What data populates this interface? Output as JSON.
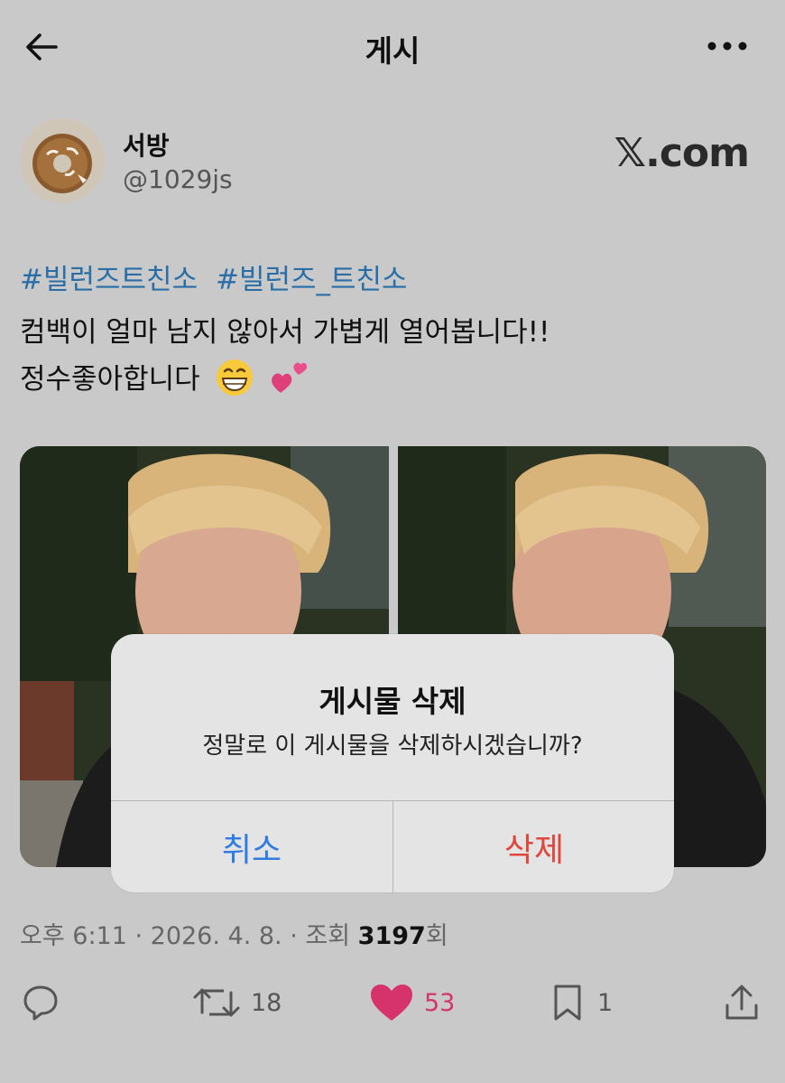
{
  "header": {
    "title": "게시"
  },
  "author": {
    "name": "서방",
    "handle": "@1029js"
  },
  "watermark": "𝕏.com",
  "post": {
    "hashtags": [
      "#빌런즈트친소",
      "#빌런즈_트친소"
    ],
    "line1": "컴백이 얼마 남지 않아서 가볍게 열어봅니다!!",
    "line2": "정수좋아합니다"
  },
  "meta": {
    "prefix": "오후 6:11 · 2026. 4. 8. · 조회",
    "views": "3197",
    "suffix": "회"
  },
  "actions": {
    "retweets": "18",
    "likes": "53",
    "bookmarks": "1"
  },
  "dialog": {
    "title": "게시물 삭제",
    "message": "정말로 이 게시물을 삭제하시겠습니까?",
    "cancel_label": "취소",
    "delete_label": "삭제"
  },
  "colors": {
    "link": "#2a6ea8",
    "cancel": "#2f7be0",
    "delete": "#e0463c",
    "like": "#d6336c"
  }
}
